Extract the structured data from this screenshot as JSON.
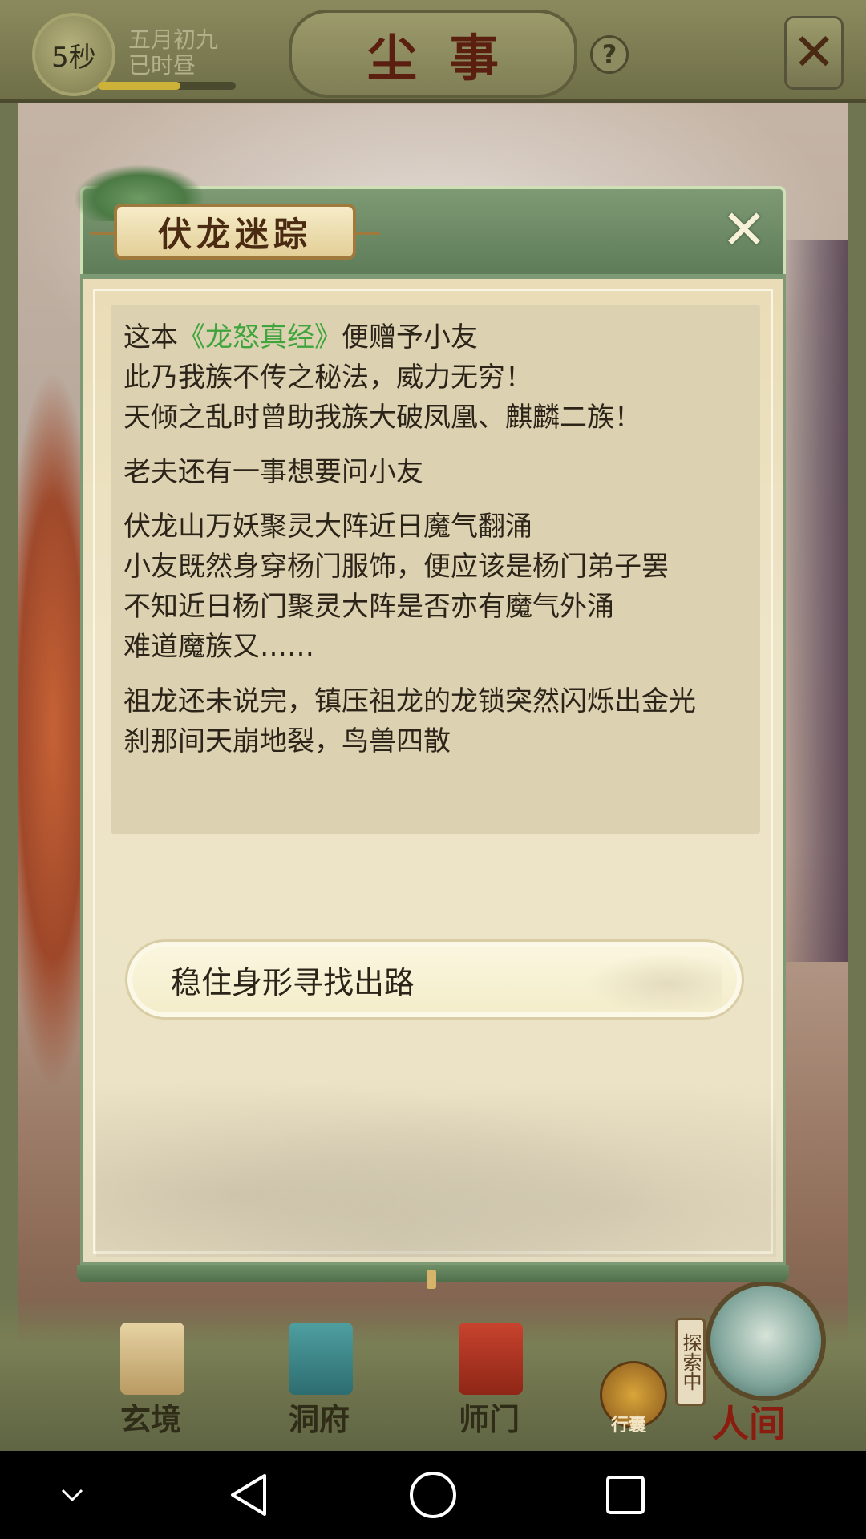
{
  "topbar": {
    "timer": "5秒",
    "date_line1": "五月初九",
    "date_line2": "已时昼",
    "day_progress": 0.6,
    "title": "尘事",
    "help_icon": "help-icon",
    "close_icon": "close-icon"
  },
  "dialog": {
    "title": "伏龙迷踪",
    "close_icon": "close-icon",
    "paragraphs": [
      {
        "lines": [
          {
            "pre": "这本",
            "highlight": "《龙怒真经》",
            "post": "便赠予小友"
          },
          {
            "pre": "此乃我族不传之秘法，威力无穷！",
            "highlight": "",
            "post": ""
          },
          {
            "pre": "天倾之乱时曾助我族大破凤凰、麒麟二族！",
            "highlight": "",
            "post": ""
          }
        ]
      },
      {
        "lines": [
          {
            "pre": "老夫还有一事想要问小友",
            "highlight": "",
            "post": ""
          }
        ]
      },
      {
        "lines": [
          {
            "pre": "伏龙山万妖聚灵大阵近日魔气翻涌",
            "highlight": "",
            "post": ""
          },
          {
            "pre": "小友既然身穿杨门服饰，便应该是杨门弟子罢",
            "highlight": "",
            "post": ""
          },
          {
            "pre": "不知近日杨门聚灵大阵是否亦有魔气外涌",
            "highlight": "",
            "post": ""
          },
          {
            "pre": "难道魔族又……",
            "highlight": "",
            "post": ""
          }
        ]
      },
      {
        "lines": [
          {
            "pre": "祖龙还未说完，镇压祖龙的龙锁突然闪烁出金光",
            "highlight": "",
            "post": ""
          },
          {
            "pre": "刹那间天崩地裂，鸟兽四散",
            "highlight": "",
            "post": ""
          }
        ]
      }
    ],
    "choice": "稳住身形寻找出路"
  },
  "bottom_nav": {
    "items": [
      "玄境",
      "洞府",
      "师门",
      "行囊",
      "人间"
    ],
    "explore_tag": "探索中"
  },
  "colors": {
    "highlight": "#3fa43c",
    "dialog_header": "#6f8c68",
    "text": "#2c2418"
  }
}
